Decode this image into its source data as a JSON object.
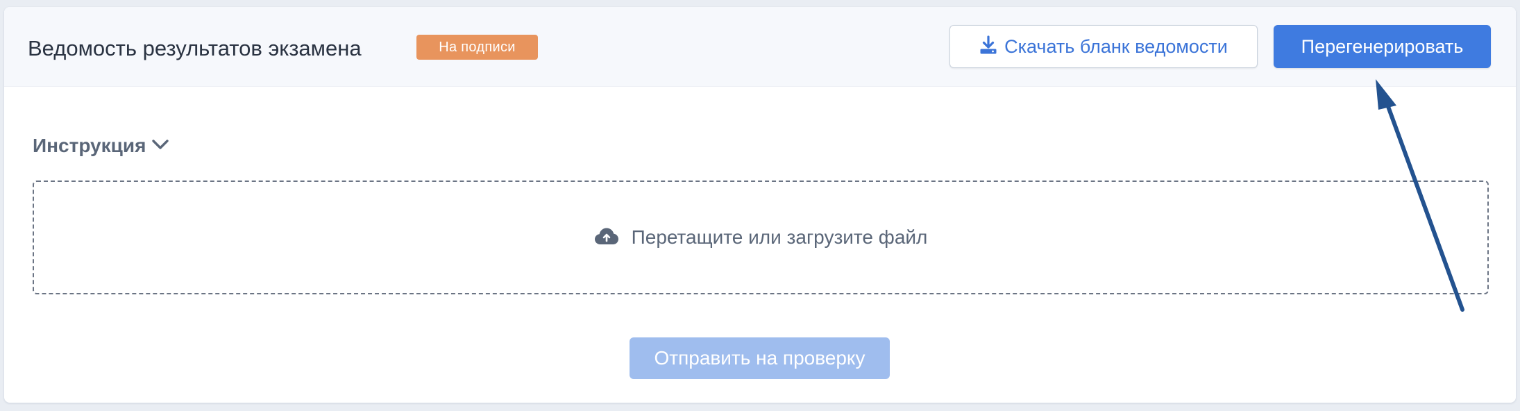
{
  "header": {
    "title": "Ведомость результатов экзамена",
    "status_badge": "На подписи",
    "download_button_label": "Скачать бланк ведомости",
    "regenerate_button_label": "Перегенерировать"
  },
  "instruction": {
    "label": "Инструкция",
    "icon": "chevron-down-icon"
  },
  "dropzone": {
    "label": "Перетащите или загрузите файл",
    "icon": "cloud-upload-icon"
  },
  "submit_button_label": "Отправить на проверку",
  "colors": {
    "accent": "#3f7be0",
    "badge": "#e8945d",
    "submit_disabled": "#9fbdee",
    "annotation_arrow": "#23528f"
  }
}
